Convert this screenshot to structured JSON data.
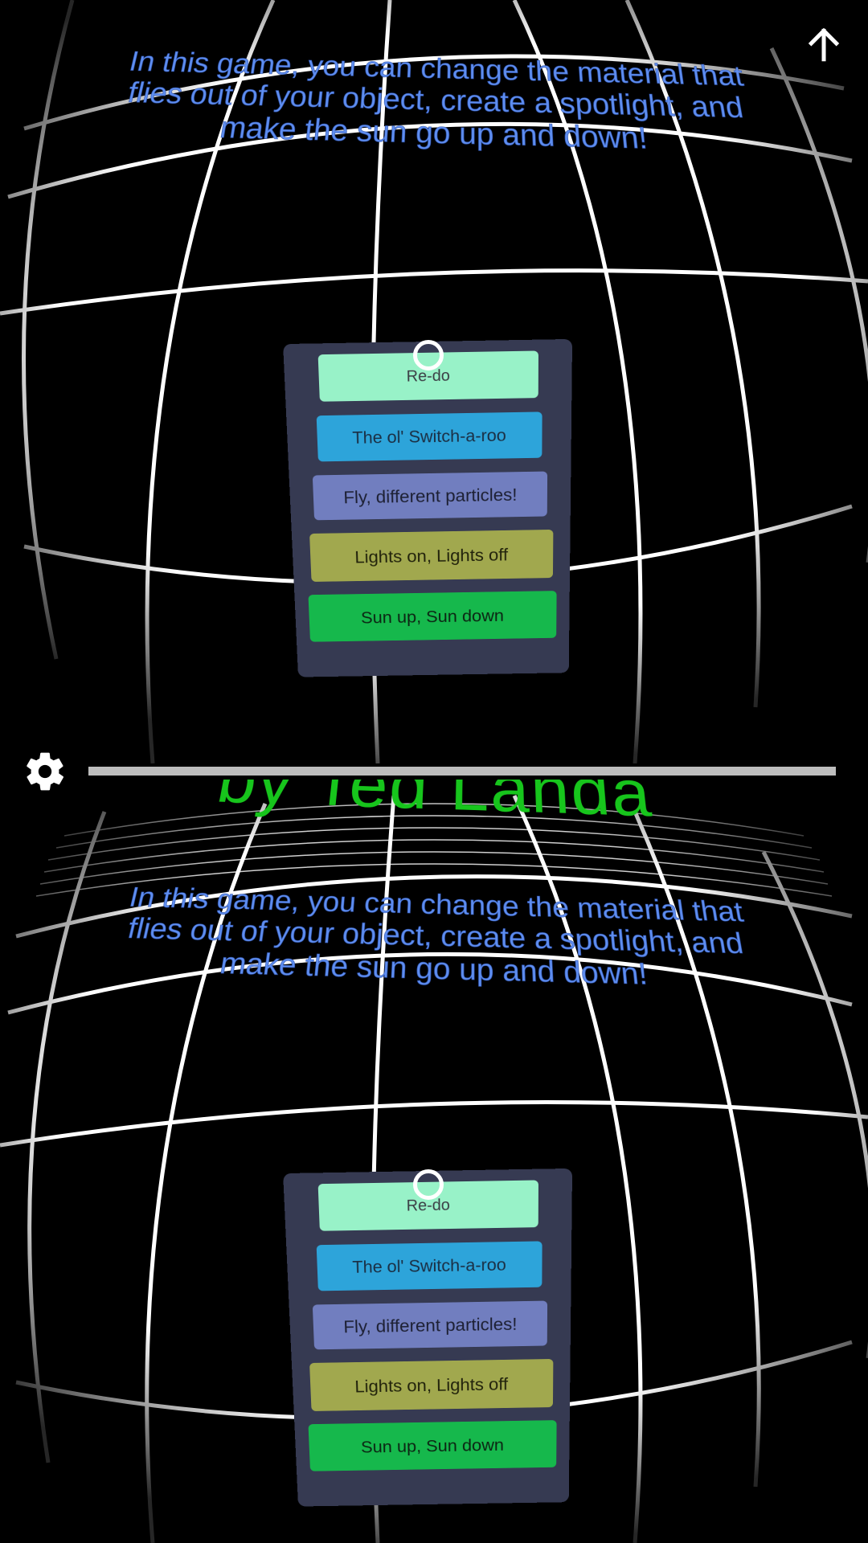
{
  "game": {
    "intro_text": "In this game, you can change the material that flies out of your object, create a spotlight, and make the sun go up and down!",
    "credit_text": "by Ted Landa"
  },
  "menu": {
    "buttons": [
      {
        "label": "Re-do",
        "color": "#98f2c8"
      },
      {
        "label": "The ol' Switch-a-roo",
        "color": "#2da4da"
      },
      {
        "label": "Fly, different particles!",
        "color": "#717ebf"
      },
      {
        "label": "Lights on, Lights off",
        "color": "#a1a84e"
      },
      {
        "label": "Sun up, Sun down",
        "color": "#16b84c"
      }
    ]
  },
  "controls": {
    "settings_icon": "gear-icon",
    "back_icon": "arrow-up-icon"
  },
  "colors": {
    "background": "#000000",
    "grid": "#ffffff",
    "intro_text": "#5f8ef0",
    "credit_text": "#17c51c",
    "panel": "#363a52",
    "divider": "#bdbdbd"
  }
}
